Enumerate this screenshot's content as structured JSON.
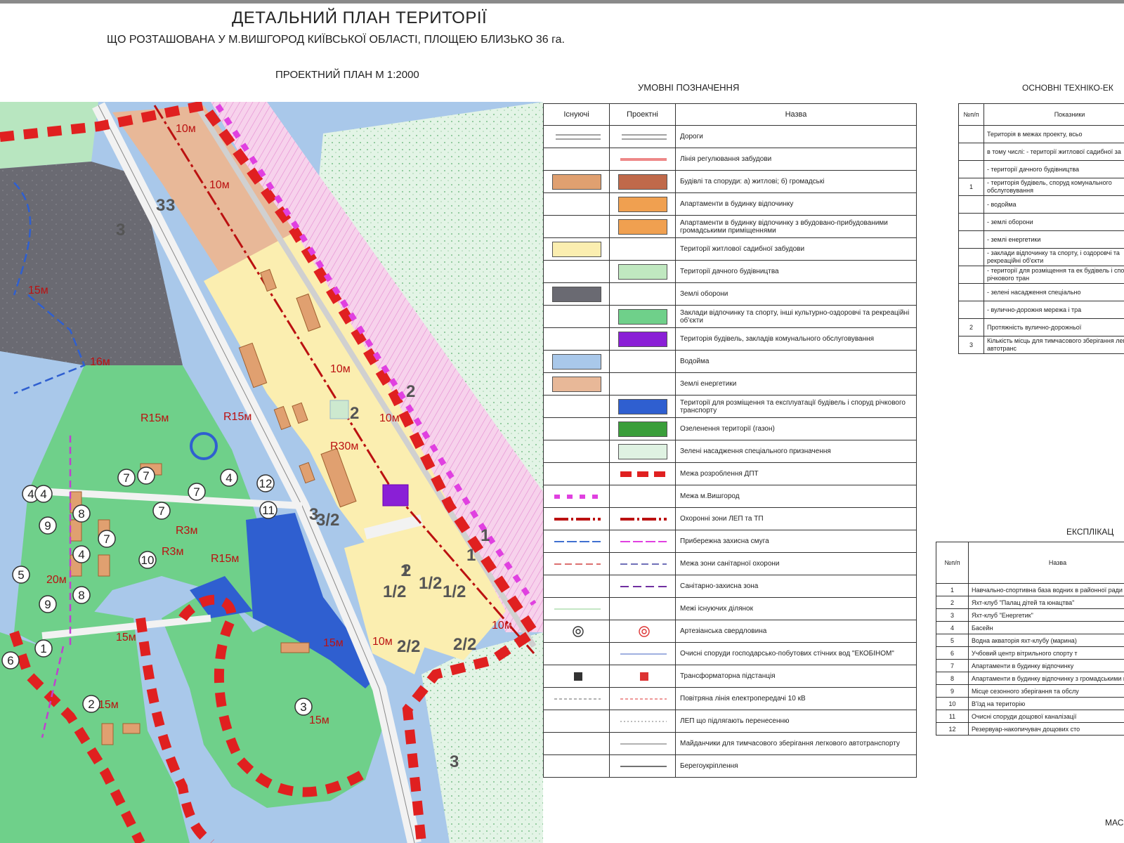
{
  "title": "ДЕТАЛЬНИЙ ПЛАН ТЕРИТОРІЇ",
  "subtitle": "ЩО РОЗТАШОВАНА У М.ВИШГОРОД КИЇВСЬКОЇ ОБЛАСТІ, ПЛОЩЕЮ БЛИЗЬКО 36 га.",
  "plan_title": "ПРОЕКТНИЙ ПЛАН М 1:2000",
  "colors": {
    "water": "#a9c8ea",
    "defense": "#6a6a72",
    "energy": "#e8b898",
    "residential": "#fbeeb0",
    "dacha": "#c0e8c0",
    "recreation": "#6fd08a",
    "river": "#2f5fd0",
    "lawn": "#3a9e3a",
    "communal": "#8a1fd6",
    "boundary": "#e02020",
    "city": "#e040e0"
  },
  "map": {
    "zones": [
      "3",
      "3",
      "3",
      "2",
      "2",
      "2",
      "1",
      "1",
      "1",
      "3",
      "3"
    ],
    "fractions": [
      "3/2",
      "1/2",
      "1/2",
      "2/2",
      "2/2",
      "1/2"
    ],
    "annotations": [
      "15м",
      "16м",
      "10м",
      "10м",
      "R15м",
      "R15м",
      "R30м",
      "10м",
      "10м",
      "R3м",
      "R15м",
      "15м",
      "15м",
      "R3м",
      "15м",
      "10м",
      "10м",
      "15м",
      "20м"
    ],
    "labels": [
      "4",
      "7",
      "7",
      "7",
      "4",
      "12",
      "11",
      "8",
      "8",
      "7",
      "4",
      "10",
      "9",
      "9",
      "5",
      "6",
      "1",
      "2",
      "3",
      "4",
      "7"
    ]
  },
  "legend": {
    "title": "УМОВНІ ПОЗНАЧЕННЯ",
    "headers": {
      "existing": "Існуючі",
      "projected": "Проектні",
      "name": "Назва"
    },
    "rows": [
      {
        "name": "Дороги"
      },
      {
        "name": "Лінія регулювання забудови"
      },
      {
        "name": "Будівлі та споруди: а) житлові; б) громадські"
      },
      {
        "name": "Апартаменти в будинку відпочинку"
      },
      {
        "name": "Апартаменти в будинку відпочинку з вбудовано-прибудованими громадськими приміщеннями"
      },
      {
        "name": "Території житлової садибної забудови"
      },
      {
        "name": "Території дачного будівництва"
      },
      {
        "name": "Землі оборони"
      },
      {
        "name": "Заклади відпочинку та спорту, інші культурно-оздоровчі та рекреаційні об'єкти"
      },
      {
        "name": "Територія будівель, закладів комунального обслуговування"
      },
      {
        "name": "Водойма"
      },
      {
        "name": "Землі енергетики"
      },
      {
        "name": "Території для розміщення та експлуатації будівель і споруд річкового транспорту"
      },
      {
        "name": "Озеленення території (газон)"
      },
      {
        "name": "Зелені насадження спеціального призначення"
      },
      {
        "name": "Межа розроблення ДПТ"
      },
      {
        "name": "Межа м.Вишгород"
      },
      {
        "name": "Охоронні зони ЛЕП та ТП"
      },
      {
        "name": "Прибережна захисна смуга"
      },
      {
        "name": "Межа зони санітарної охорони"
      },
      {
        "name": "Санітарно-захисна зона"
      },
      {
        "name": "Межі існуючих ділянок"
      },
      {
        "name": "Артезіанська свердловина"
      },
      {
        "name": "Очисні споруди господарсько-побутових стічних вод \"ЕКОБІНОМ\""
      },
      {
        "name": "Трансформаторна підстанція"
      },
      {
        "name": "Повітряна лінія електропередачі 10 кВ"
      },
      {
        "name": "ЛЕП що підлягають перенесенню"
      },
      {
        "name": "Майданчики для тимчасового зберігання легкового автотранспорту"
      },
      {
        "name": "Берегоукріплення"
      }
    ]
  },
  "tei": {
    "title": "ОСНОВНІ ТЕХНІКО-ЕК",
    "headers": {
      "num": "№п/п",
      "name": "Показники"
    },
    "rows": [
      {
        "num": "",
        "name": "Територія в межах проекту, всьо"
      },
      {
        "num": "",
        "name": "в тому числі: - території житлової садибної за"
      },
      {
        "num": "",
        "name": "- території дачного будівництва"
      },
      {
        "num": "1",
        "name": "- територія будівель, споруд комунального обслуговування"
      },
      {
        "num": "",
        "name": "- водойма"
      },
      {
        "num": "",
        "name": "- землі оборони"
      },
      {
        "num": "",
        "name": "- землі енергетики"
      },
      {
        "num": "",
        "name": "- заклади відпочинку та спорту, і оздоровчі та рекреаційні об'єкти"
      },
      {
        "num": "",
        "name": "- території для розміщення та ек будівель і споруд річкового тран"
      },
      {
        "num": "",
        "name": "- зелені насадження спеціально"
      },
      {
        "num": "",
        "name": "- вулично-дорожня мережа і тра"
      },
      {
        "num": "2",
        "name": "Протяжність вулично-дорожньої"
      },
      {
        "num": "3",
        "name": "Кількість місць для тимчасового зберігання легкового автотранс"
      }
    ]
  },
  "explication": {
    "title": "ЕКСПЛІКАЦ",
    "headers": {
      "num": "№п/п",
      "name": "Назва"
    },
    "rows": [
      {
        "num": "1",
        "name": "Навчально-спортивна база водних в районної ради"
      },
      {
        "num": "2",
        "name": "Яхт-клуб \"Палац дітей та юнацтва\""
      },
      {
        "num": "3",
        "name": "Яхт-клуб \"Енергетик\""
      },
      {
        "num": "4",
        "name": "Басейн"
      },
      {
        "num": "5",
        "name": "Водна акваторія яхт-клубу (марина)"
      },
      {
        "num": "6",
        "name": "Учбовий центр вітрильного спорту т"
      },
      {
        "num": "7",
        "name": "Апартаменти в будинку відпочинку"
      },
      {
        "num": "8",
        "name": "Апартаменти в будинку відпочинку з громадськими приміщеннями"
      },
      {
        "num": "9",
        "name": "Місце сезонного зберігання та обслу"
      },
      {
        "num": "10",
        "name": "В'їзд на територію"
      },
      {
        "num": "11",
        "name": "Очисні споруди дощової каналізації"
      },
      {
        "num": "12",
        "name": "Резервуар-накопичувач дощових сто"
      }
    ]
  },
  "scale_note": "МАС"
}
